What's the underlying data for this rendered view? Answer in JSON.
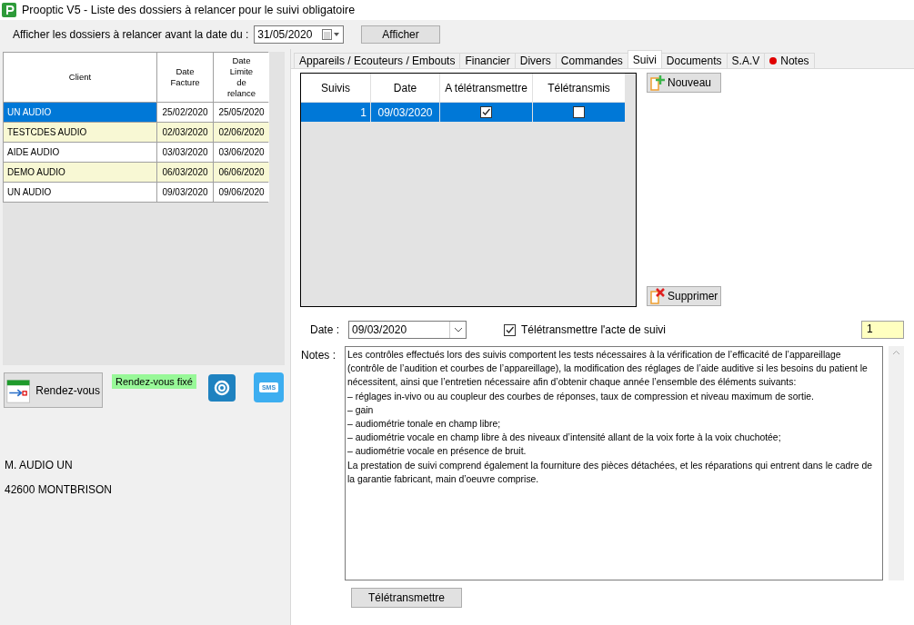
{
  "window": {
    "title": "Prooptic V5 - Liste des dossiers à relancer pour le suivi obligatoire"
  },
  "filter": {
    "label": "Afficher les dossiers à relancer avant la date du :",
    "value": "31/05/2020",
    "button": "Afficher"
  },
  "clients": {
    "columns": [
      "Client",
      "Date\nFacture",
      "Date\nLimite\nde\nrelance"
    ],
    "rows": [
      {
        "client": "UN AUDIO",
        "date_facture": "25/02/2020",
        "date_limite": "25/05/2020",
        "selected": true
      },
      {
        "client": "TESTCDES AUDIO",
        "date_facture": "02/03/2020",
        "date_limite": "02/06/2020",
        "selected": false
      },
      {
        "client": "AIDE AUDIO",
        "date_facture": "03/03/2020",
        "date_limite": "03/06/2020",
        "selected": false
      },
      {
        "client": "DEMO AUDIO",
        "date_facture": "06/03/2020",
        "date_limite": "06/06/2020",
        "selected": false
      },
      {
        "client": "UN AUDIO",
        "date_facture": "09/03/2020",
        "date_limite": "09/06/2020",
        "selected": false
      }
    ]
  },
  "appointment": {
    "button": "Rendez-vous",
    "status": "Rendez-vous fixé",
    "sms_label": "SMS"
  },
  "address": [
    "M. AUDIO UN",
    "42600 MONTBRISON"
  ],
  "tabs": [
    {
      "label": "Appareils / Ecouteurs / Embouts",
      "selected": false
    },
    {
      "label": "Financier",
      "selected": false
    },
    {
      "label": "Divers",
      "selected": false
    },
    {
      "label": "Commandes",
      "selected": false
    },
    {
      "label": "Suivi",
      "selected": true
    },
    {
      "label": "Documents",
      "selected": false
    },
    {
      "label": "S.A.V",
      "selected": false
    },
    {
      "label": "Notes",
      "selected": false,
      "color": "#e00000"
    }
  ],
  "suivis": {
    "columns": [
      "Suivis",
      "Date",
      "A télétransmettre",
      "Télétransmis"
    ],
    "rows": [
      {
        "number": "1",
        "date": "09/03/2020",
        "a_teletransmettre": true,
        "teletransmis": false,
        "selected": true
      }
    ]
  },
  "buttons": {
    "new": "Nouveau",
    "delete": "Supprimer",
    "transmit": "Télétransmettre"
  },
  "detail": {
    "date_label": "Date :",
    "date_value": "09/03/2020",
    "transmit_label": "Télétransmettre l'acte de suivi",
    "transmit_checked": true,
    "counter": "1",
    "notes_label": "Notes :",
    "notes": [
      "Les contrôles effectués lors des suivis comportent les tests nécessaires à la vérification de l’efficacité de l’appareillage",
      "(contrôle de l’audition et courbes de l’appareillage), la modification des réglages de l’aide auditive si les besoins du patient le",
      "nécessitent, ainsi que l’entretien nécessaire afin d’obtenir chaque année l’ensemble des éléments suivants:",
      "– réglages in-vivo ou au coupleur des courbes de réponses, taux de compression et niveau maximum de sortie.",
      "– gain",
      "– audiométrie tonale en champ libre;",
      "– audiométrie vocale en champ libre à des niveaux d’intensité allant de la voix forte à la voix chuchotée;",
      "– audiométrie vocale en présence de bruit.",
      "La prestation de suivi comprend également la fourniture des pièces détachées, et les réparations qui entrent dans le cadre de",
      "la garantie fabricant, main d’oeuvre comprise."
    ]
  }
}
